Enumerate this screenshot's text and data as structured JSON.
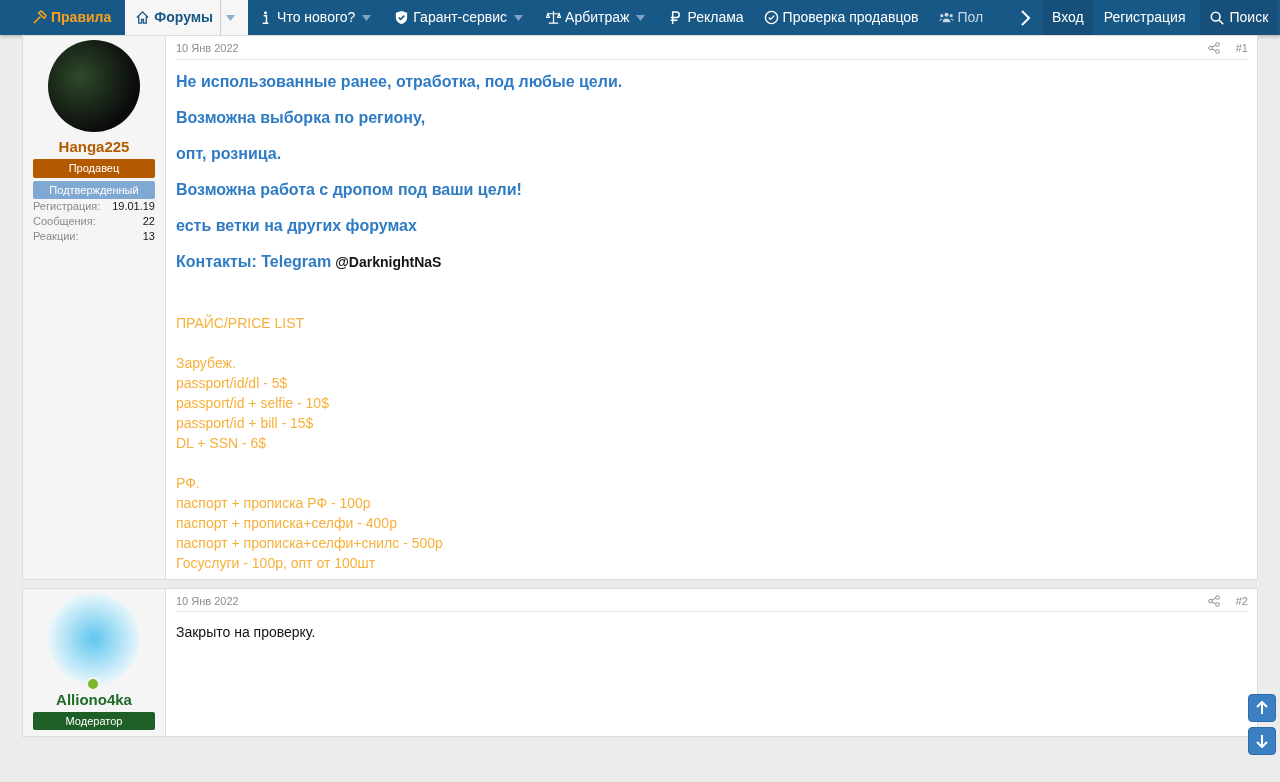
{
  "nav": {
    "items": [
      {
        "label": "Правила",
        "kind": "highlight",
        "dropdown": false,
        "selected": false
      },
      {
        "label": "Форумы",
        "kind": "normal",
        "dropdown": true,
        "selected": true
      },
      {
        "label": "Что нового?",
        "kind": "normal",
        "dropdown": true,
        "selected": false
      },
      {
        "label": "Гарант-сервис",
        "kind": "normal",
        "dropdown": true,
        "selected": false
      },
      {
        "label": "Арбитраж",
        "kind": "normal",
        "dropdown": true,
        "selected": false
      },
      {
        "label": "Реклама",
        "kind": "normal",
        "dropdown": false,
        "selected": false
      },
      {
        "label": "Проверка продавцов",
        "kind": "normal",
        "dropdown": false,
        "selected": false
      },
      {
        "label": "Пол",
        "kind": "faded",
        "dropdown": false,
        "selected": false
      }
    ],
    "account": [
      "Вход",
      "Регистрация"
    ],
    "search": "Поиск"
  },
  "posts": [
    {
      "user": {
        "name": "Hanga225",
        "color": "#b35c00",
        "online": false,
        "badges": [
          {
            "text": "Продавец",
            "color": "#b35a00"
          },
          {
            "text": "Подтвержденный",
            "color": "#7fa9d3"
          }
        ],
        "stats": [
          {
            "label": "Регистрация:",
            "value": "19.01.19"
          },
          {
            "label": "Сообщения:",
            "value": "22"
          },
          {
            "label": "Реакции:",
            "value": "13"
          }
        ]
      },
      "date": "10 Янв 2022",
      "number": "#1",
      "blocks": [
        {
          "kind": "lead",
          "text": "Не использованные ранее, отработка, под любые цели."
        },
        {
          "kind": "lead",
          "text": "Возможна выборка по региону,"
        },
        {
          "kind": "lead",
          "text": "опт, розница."
        },
        {
          "kind": "lead",
          "text": "Возможна работа с дропом под ваши цели!"
        },
        {
          "kind": "lead",
          "text": "есть ветки на других форумах"
        },
        {
          "kind": "contact",
          "text": "Контакты: Telegram",
          "handle": "@DarknightNaS"
        },
        {
          "kind": "price",
          "groups": [
            [
              "ПРАЙС/PRICE LIST"
            ],
            [
              "Зарубеж.",
              "passport/id/dl - 5$",
              "passport/id + selfie - 10$",
              "passport/id + bill - 15$",
              "DL + SSN - 6$"
            ],
            [
              "РФ.",
              "паспорт + прописка РФ - 100р",
              "паспорт + прописка+селфи - 400р",
              "паспорт + прописка+селфи+снилс - 500р",
              "Госуслуги - 100р, опт от 100шт"
            ]
          ]
        }
      ]
    },
    {
      "user": {
        "name": "Alliono4ka",
        "color": "#1e6b2a",
        "online": true,
        "badges": [
          {
            "text": "Модератор",
            "color": "#1d5f27"
          }
        ]
      },
      "date": "10 Янв 2022",
      "number": "#2",
      "blocks": [
        {
          "kind": "plain",
          "text": "Закрыто на проверку."
        }
      ]
    }
  ]
}
